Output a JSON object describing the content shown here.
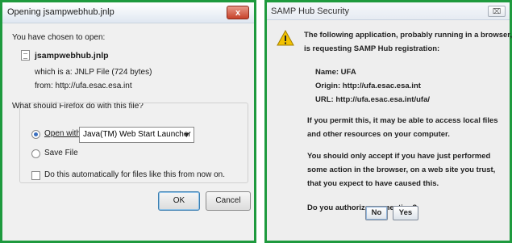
{
  "left_dialog": {
    "title": "Opening jsampwebhub.jnlp",
    "close_label": "x",
    "chosen_label": "You have chosen to open:",
    "filename": "jsampwebhub.jnlp",
    "which_is": "which is a:  JNLP File (724 bytes)",
    "from": "from:  http://ufa.esac.esa.int",
    "question": "What should Firefox do with this file?",
    "open_with_label": "Open with",
    "open_with_value": "Java(TM) Web Start Launcher (default)",
    "save_file_label": "Save File",
    "auto_label": "Do this automatically for files like this from now on.",
    "ok_label": "OK",
    "cancel_label": "Cancel",
    "options": {
      "open_with_selected": true,
      "save_file_selected": false,
      "auto_checked": false
    }
  },
  "right_dialog": {
    "title": "SAMP Hub Security",
    "close_label": "⌧",
    "message_lines": [
      "The following application, probably running in a browser,",
      "is requesting SAMP Hub registration:"
    ],
    "details": [
      "Name: UFA",
      "Origin: http://ufa.esac.esa.int",
      "URL: http://ufa.esac.esa.int/ufa/"
    ],
    "permit_lines": [
      "If you permit this, it may be able to access local files",
      "and other resources on your computer."
    ],
    "accept_lines": [
      "You should only accept if you have just performed",
      "some action in the browser, on a web site you trust,",
      "that you expect to have caused this."
    ],
    "question": "Do you authorize connection?",
    "no_label": "No",
    "yes_label": "Yes"
  },
  "colors": {
    "frame_border": "#1e9a3e",
    "warning": "#f2c200"
  }
}
